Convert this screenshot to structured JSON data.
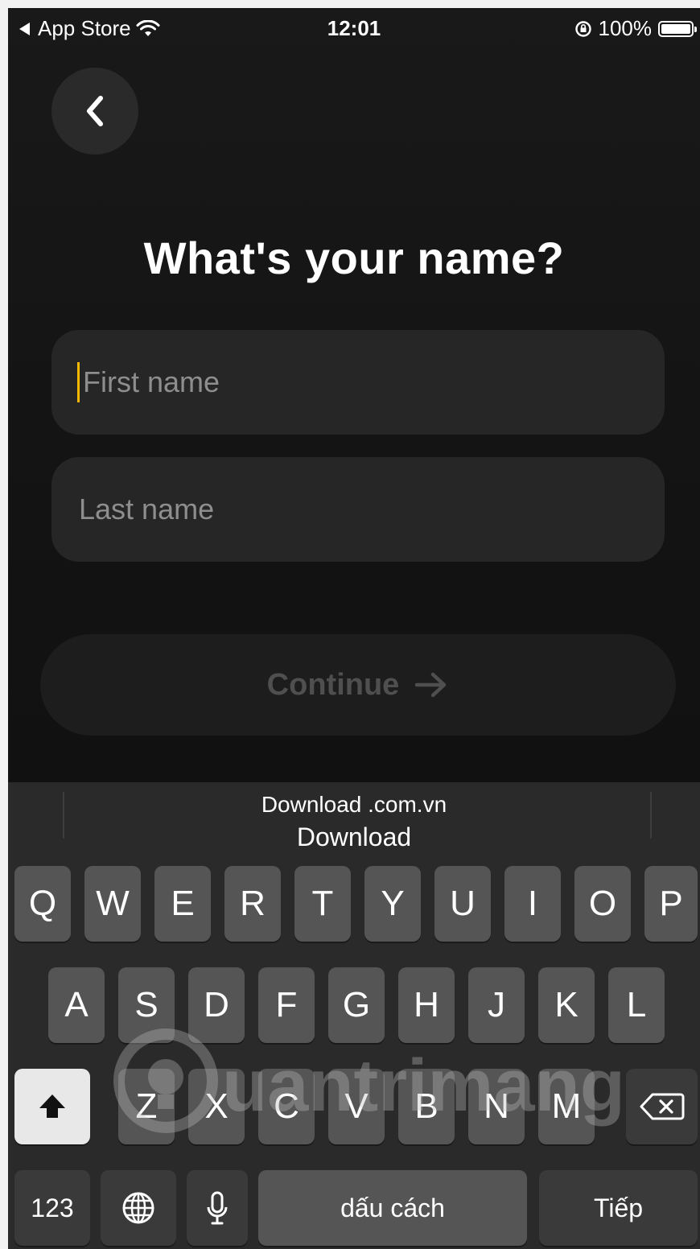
{
  "status_bar": {
    "back_app": "App Store",
    "time": "12:01",
    "battery_level": "100%"
  },
  "back_button": {
    "icon": "chevron-left-icon"
  },
  "title": "What's your name?",
  "form": {
    "first_name_placeholder": "First name",
    "last_name_placeholder": "Last name",
    "continue_label": "Continue"
  },
  "keyboard": {
    "suggestion_top": "Download .com.vn",
    "suggestion_main": "Download",
    "row1": [
      "Q",
      "W",
      "E",
      "R",
      "T",
      "Y",
      "U",
      "I",
      "O",
      "P"
    ],
    "row2": [
      "A",
      "S",
      "D",
      "F",
      "G",
      "H",
      "J",
      "K",
      "L"
    ],
    "row3": [
      "Z",
      "X",
      "C",
      "V",
      "B",
      "N",
      "M"
    ],
    "numbers_label": "123",
    "space_label": "dấu cách",
    "return_label": "Tiếp"
  },
  "watermark": "uantrimang",
  "colors": {
    "cursor": "#f5b800",
    "background": "#131313",
    "field": "#262626"
  }
}
